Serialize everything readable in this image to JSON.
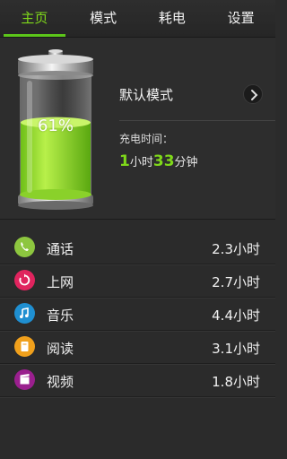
{
  "tabs": [
    {
      "label": "主页",
      "active": true
    },
    {
      "label": "模式",
      "active": false
    },
    {
      "label": "耗电",
      "active": false
    },
    {
      "label": "设置",
      "active": false
    }
  ],
  "battery": {
    "level_text": "61%",
    "level": 0.61,
    "fill_color": "#9be22a"
  },
  "mode": {
    "label": "默认模式"
  },
  "charging": {
    "label": "充电时间：",
    "hours": "1",
    "hours_unit": "小时",
    "minutes": "33",
    "minutes_unit": "分钟"
  },
  "usage": [
    {
      "name": "通话",
      "value": "2.3小时",
      "icon": "phone-icon",
      "color": "#8dc63f"
    },
    {
      "name": "上网",
      "value": "2.7小时",
      "icon": "refresh-icon",
      "color": "#e0245e"
    },
    {
      "name": "音乐",
      "value": "4.4小时",
      "icon": "music-note-icon",
      "color": "#1f8fd1"
    },
    {
      "name": "阅读",
      "value": "3.1小时",
      "icon": "book-icon",
      "color": "#f0a01c"
    },
    {
      "name": "视频",
      "value": "1.8小时",
      "icon": "video-icon",
      "color": "#9a1f8e"
    }
  ],
  "colors": {
    "accent": "#7fd81a",
    "background": "#2b2b2b"
  }
}
